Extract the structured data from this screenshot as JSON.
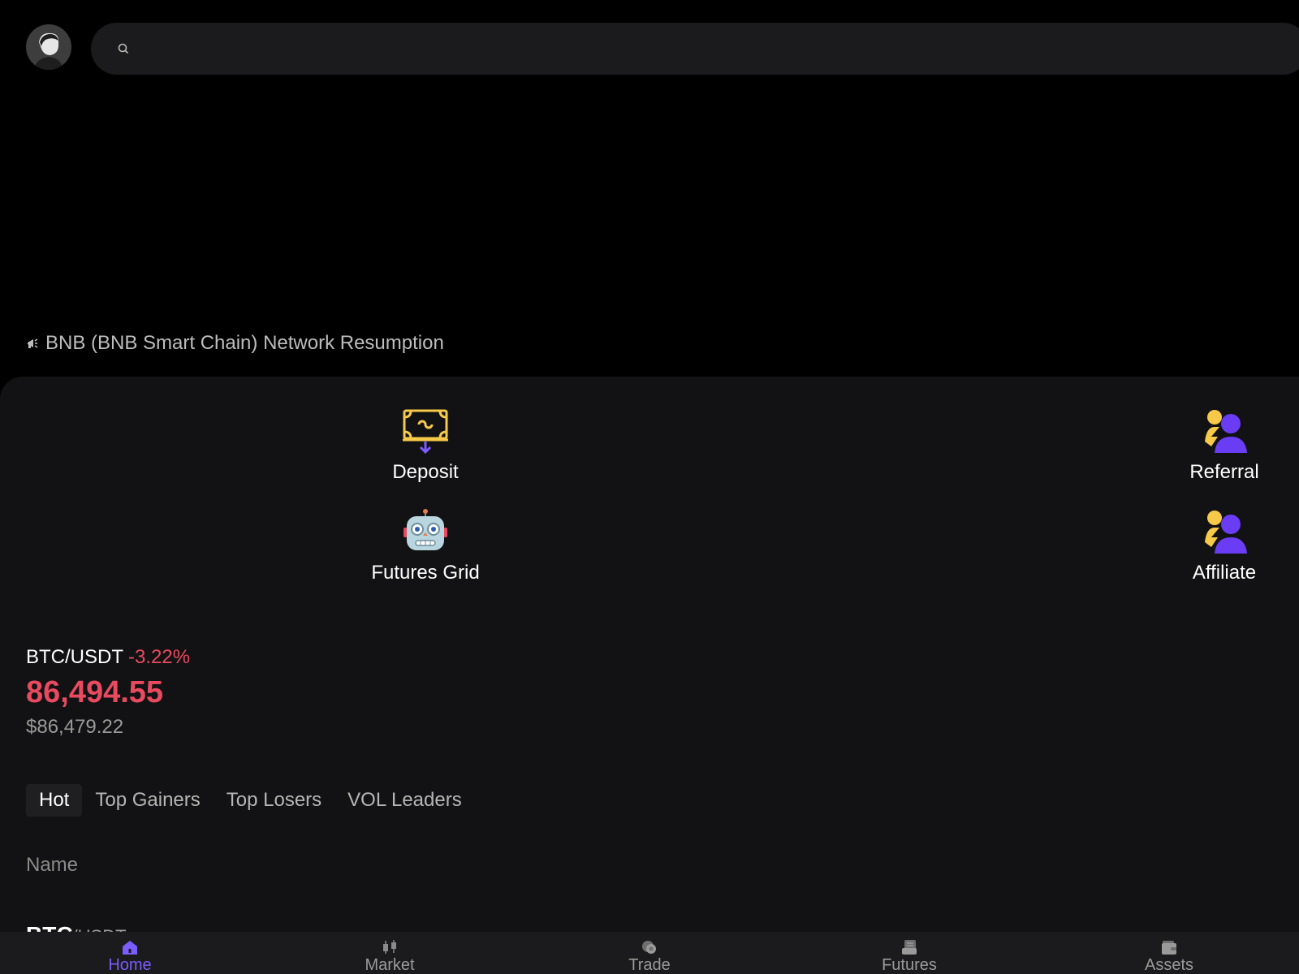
{
  "header": {
    "search_placeholder": ""
  },
  "announcement": {
    "text": "BNB (BNB Smart Chain) Network Resumption"
  },
  "quick_actions": [
    {
      "label": "Deposit",
      "icon": "deposit-icon"
    },
    {
      "label": "Referral",
      "icon": "referral-icon"
    },
    {
      "label": "Futures Grid",
      "icon": "robot-icon"
    },
    {
      "label": "Affiliate",
      "icon": "affiliate-icon"
    }
  ],
  "ticker": {
    "pair": "BTC/USDT",
    "change": "-3.22%",
    "price": "86,494.55",
    "usd_price": "$86,479.22"
  },
  "market_tabs": [
    {
      "label": "Hot",
      "active": true
    },
    {
      "label": "Top Gainers",
      "active": false
    },
    {
      "label": "Top Losers",
      "active": false
    },
    {
      "label": "VOL Leaders",
      "active": false
    }
  ],
  "table": {
    "column_name": "Name",
    "first_row_base": "BTC",
    "first_row_quote": "/USDT"
  },
  "bottom_nav": [
    {
      "label": "Home",
      "icon": "home-icon",
      "active": true
    },
    {
      "label": "Market",
      "icon": "candlestick-icon",
      "active": false
    },
    {
      "label": "Trade",
      "icon": "trade-icon",
      "active": false
    },
    {
      "label": "Futures",
      "icon": "futures-icon",
      "active": false
    },
    {
      "label": "Assets",
      "icon": "wallet-icon",
      "active": false
    }
  ],
  "colors": {
    "accent": "#7a5cff",
    "negative": "#e84a5f",
    "yellow": "#f7c948",
    "panel_bg": "#121214"
  }
}
